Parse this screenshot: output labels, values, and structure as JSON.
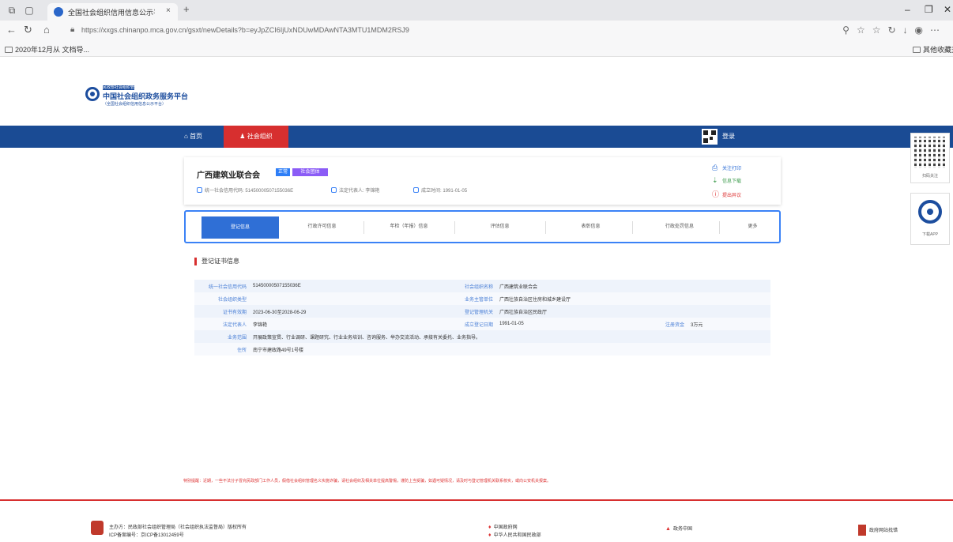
{
  "browser": {
    "tab_title": "全国社会组织信用信息公示平台",
    "tab_close": "×",
    "new_tab": "+",
    "url": "https://xxgs.chinanpo.mca.gov.cn/gsxt/newDetails?b=eyJpZCI6IjUxNDUwMDAwNTA3MTU1MDM2RSJ9",
    "bookmark_left": "2020年12月从 文档导...",
    "bookmark_right": "其他收藏夹",
    "minimize": "–",
    "restore": "❐",
    "close": "✕"
  },
  "site": {
    "logo_tag": "民政部社会组织管理局",
    "logo_name": "中国社会组织政务服务平台",
    "logo_sub": "（全国社会组织信用信息公示平台）",
    "nav_home": "首页",
    "nav_active": "社会组织",
    "user_label": "登录",
    "qr_caption": "扫码关注",
    "app_caption": "下载APP"
  },
  "org": {
    "name": "广西建筑业联合会",
    "badge_status": "正常",
    "badge_type": "社会团体",
    "credit_code_label": "统一社会信用代码",
    "credit_code": "51450000507155036E",
    "legal_rep_label": "法定代表人",
    "legal_rep": "李锦艳",
    "established_label": "成立时间",
    "established": "1991-01-05",
    "actions": [
      "关注打印",
      "信息下载",
      "提出异议"
    ]
  },
  "tabs": [
    {
      "label": "登记信息",
      "active": true
    },
    {
      "label": "行政许可信息",
      "active": false
    },
    {
      "label": "年检（年报）信息",
      "active": false
    },
    {
      "label": "评估信息",
      "active": false
    },
    {
      "label": "表彰信息",
      "active": false
    },
    {
      "label": "行政处罚信息",
      "active": false
    },
    {
      "label": "更多",
      "active": false
    }
  ],
  "section": {
    "title": "登记证书信息",
    "rows": [
      {
        "k1": "统一社会信用代码",
        "v1": "51450000507155036E",
        "k2": "社会组织名称",
        "v2": "广西建筑业联合会",
        "k3": "",
        "v3": ""
      },
      {
        "k1": "社会组织类型",
        "v1": "",
        "k2": "业务主管单位",
        "v2": "广西壮族自治区住房和城乡建设厅",
        "k3": "",
        "v3": ""
      },
      {
        "k1": "证书有效期",
        "v1": "2023-06-30至2028-06-29",
        "k2": "登记管理机关",
        "v2": "广西壮族自治区民政厅",
        "k3": "",
        "v3": ""
      },
      {
        "k1": "法定代表人",
        "v1": "李锦艳",
        "k2": "成立登记日期",
        "v2": "1991-01-05",
        "k3": "注册资金",
        "v3": "3万元"
      },
      {
        "k1": "业务范围",
        "v1": "开展政策宣贯、行业调研、课题研究、行业业务培训、咨询服务、举办交流活动、承接有关委托、业务指导。",
        "k2": "",
        "v2": "",
        "k3": "",
        "v3": ""
      },
      {
        "k1": "住所",
        "v1": "南宁市建政路49号1号楼",
        "k2": "",
        "v2": "",
        "k3": "",
        "v3": ""
      }
    ]
  },
  "footer": {
    "disclaimer": "特别提醒：近期，一些不法分子冒充民政部门工作人员，假借社会组织管理名义实施诈骗，请社会组织及相关单位提高警惕，谨防上当受骗，如遇可疑情况，请及时与登记管理机关联系核实，或向公安机关报案。",
    "host": "主办方：民政部社会组织管理局（社会组织执法监督局）版权所有",
    "icp": "ICP备案编号：京ICP备13012459号",
    "link1": "中国政府网",
    "link2": "中华人民共和国民政部",
    "link3": "政务中国",
    "link4": "政府网站找错"
  }
}
